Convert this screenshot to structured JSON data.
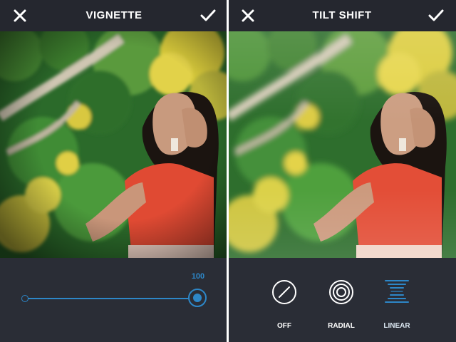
{
  "left_panel": {
    "title": "VIGNETTE",
    "close_icon": "close-x-icon",
    "confirm_icon": "checkmark-icon",
    "slider": {
      "value_label": "100",
      "value": 100,
      "min": 0,
      "max": 100
    }
  },
  "right_panel": {
    "title": "TILT SHIFT",
    "close_icon": "close-x-icon",
    "confirm_icon": "checkmark-icon",
    "options": [
      {
        "label": "OFF",
        "icon": "off-slash-icon",
        "selected": false
      },
      {
        "label": "RADIAL",
        "icon": "radial-rings-icon",
        "selected": false
      },
      {
        "label": "LINEAR",
        "icon": "linear-lines-icon",
        "selected": true
      }
    ]
  },
  "colors": {
    "accent": "#2d87c8",
    "background": "#2a2d36",
    "top_bar": "#25272f",
    "text": "#ffffff"
  }
}
